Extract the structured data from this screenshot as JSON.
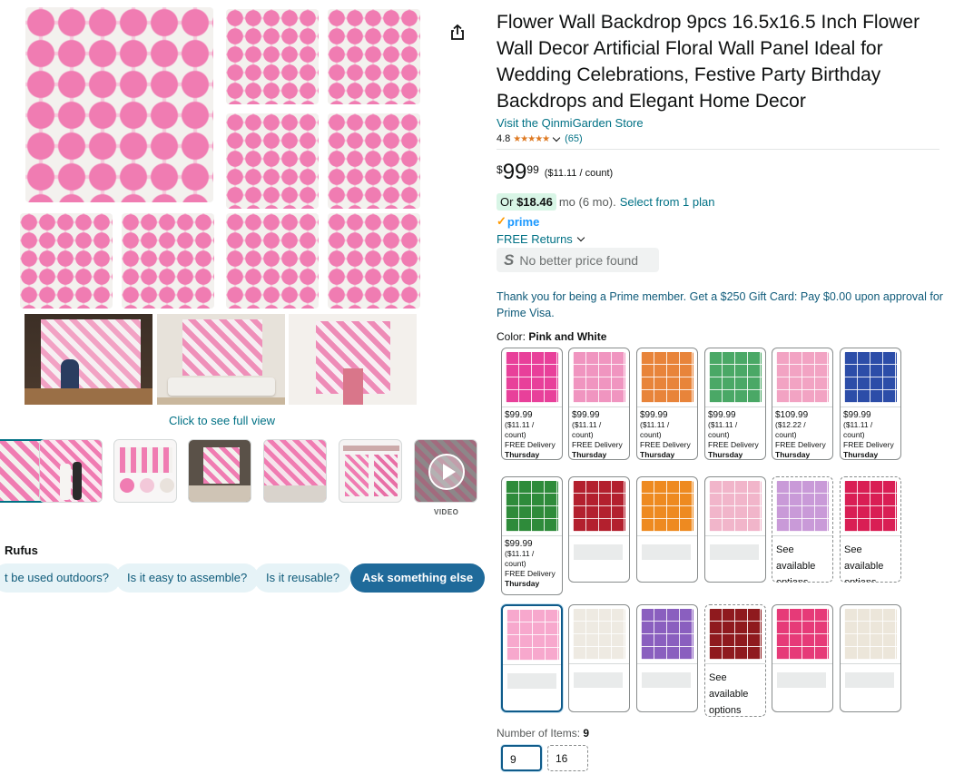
{
  "product": {
    "title": "Flower Wall Backdrop 9pcs 16.5x16.5 Inch Flower Wall Decor Artificial Floral Wall Panel Ideal for Wedding Celebrations, Festive Party Birthday Backdrops and Elegant Home Decor",
    "store_link": "Visit the QinmiGarden Store",
    "rating": "4.8",
    "stars": "★★★★★",
    "review_count": "(65)"
  },
  "price": {
    "symbol": "$",
    "whole": "99",
    "fraction": "99",
    "per_unit": "($11.11 / count)",
    "monthly_or": "Or",
    "monthly_amount": "$18.46",
    "monthly_term": "mo (6 mo).",
    "plan_link": "Select from 1 plan"
  },
  "prime": {
    "check": "✓",
    "label": "prime"
  },
  "returns": "FREE Returns",
  "no_better_price": {
    "icon": "S",
    "text": "No better price found"
  },
  "prime_visa_offer": "Thank you for being a Prime member. Get a $250 Gift Card: Pay $0.00 upon approval for Prime Visa.",
  "color": {
    "label": "Color:",
    "selected": "Pink and White"
  },
  "swatches": [
    {
      "price": "$99.99",
      "unit": "($11.11 /",
      "unit2": "count)",
      "delivery": "FREE Delivery",
      "day": "Thursday",
      "color": "#e8409a"
    },
    {
      "price": "$99.99",
      "unit": "($11.11 /",
      "unit2": "count)",
      "delivery": "FREE Delivery",
      "day": "Thursday",
      "color": "#f095c0"
    },
    {
      "price": "$99.99",
      "unit": "($11.11 /",
      "unit2": "count)",
      "delivery": "FREE Delivery",
      "day": "Thursday",
      "color": "#e8843a"
    },
    {
      "price": "$99.99",
      "unit": "($11.11 /",
      "unit2": "count)",
      "delivery": "FREE Delivery",
      "day": "Thursday",
      "color": "#4aa866"
    },
    {
      "price": "$109.99",
      "unit": "($12.22 /",
      "unit2": "count)",
      "delivery": "FREE Delivery",
      "day": "Thursday",
      "color": "#f2a3c3"
    },
    {
      "price": "$99.99",
      "unit": "($11.11 /",
      "unit2": "count)",
      "delivery": "FREE Delivery",
      "day": "Thursday",
      "color": "#2c4da8"
    },
    {
      "price": "$99.99",
      "unit": "($11.11 /",
      "unit2": "count)",
      "delivery": "FREE Delivery",
      "day": "Thursday",
      "color": "#2e8b3a"
    },
    {
      "color": "#b3202e"
    },
    {
      "color": "#ee8a20"
    },
    {
      "color": "#f1b5ca"
    },
    {
      "see": [
        "See",
        "available",
        "options"
      ],
      "color": "#c99ad8"
    },
    {
      "see": [
        "See",
        "available",
        "options"
      ],
      "color": "#d91e54"
    },
    {
      "color": "#f7a8cd"
    },
    {
      "color": "#eeeae2"
    },
    {
      "color": "#8a5fbf"
    },
    {
      "see": [
        "See",
        "available",
        "options"
      ],
      "color": "#8f1a1e"
    },
    {
      "color": "#e63a78"
    },
    {
      "color": "#ece6da"
    }
  ],
  "number_of_items": {
    "label": "Number of Items:",
    "selected": "9",
    "options": [
      "9",
      "16"
    ]
  },
  "gallery": {
    "click_full_view": "Click to see full view",
    "video_label": "VIDEO"
  },
  "rufus": {
    "label": "Rufus",
    "questions": [
      "t be used outdoors?",
      "Is it easy to assemble?",
      "Is it reusable?",
      "Ask something else"
    ]
  },
  "colors": {
    "link": "#007185",
    "star": "#de7921",
    "prime": "#1a98ff",
    "pink": "#f07cb2",
    "white": "#f3f1ee"
  }
}
